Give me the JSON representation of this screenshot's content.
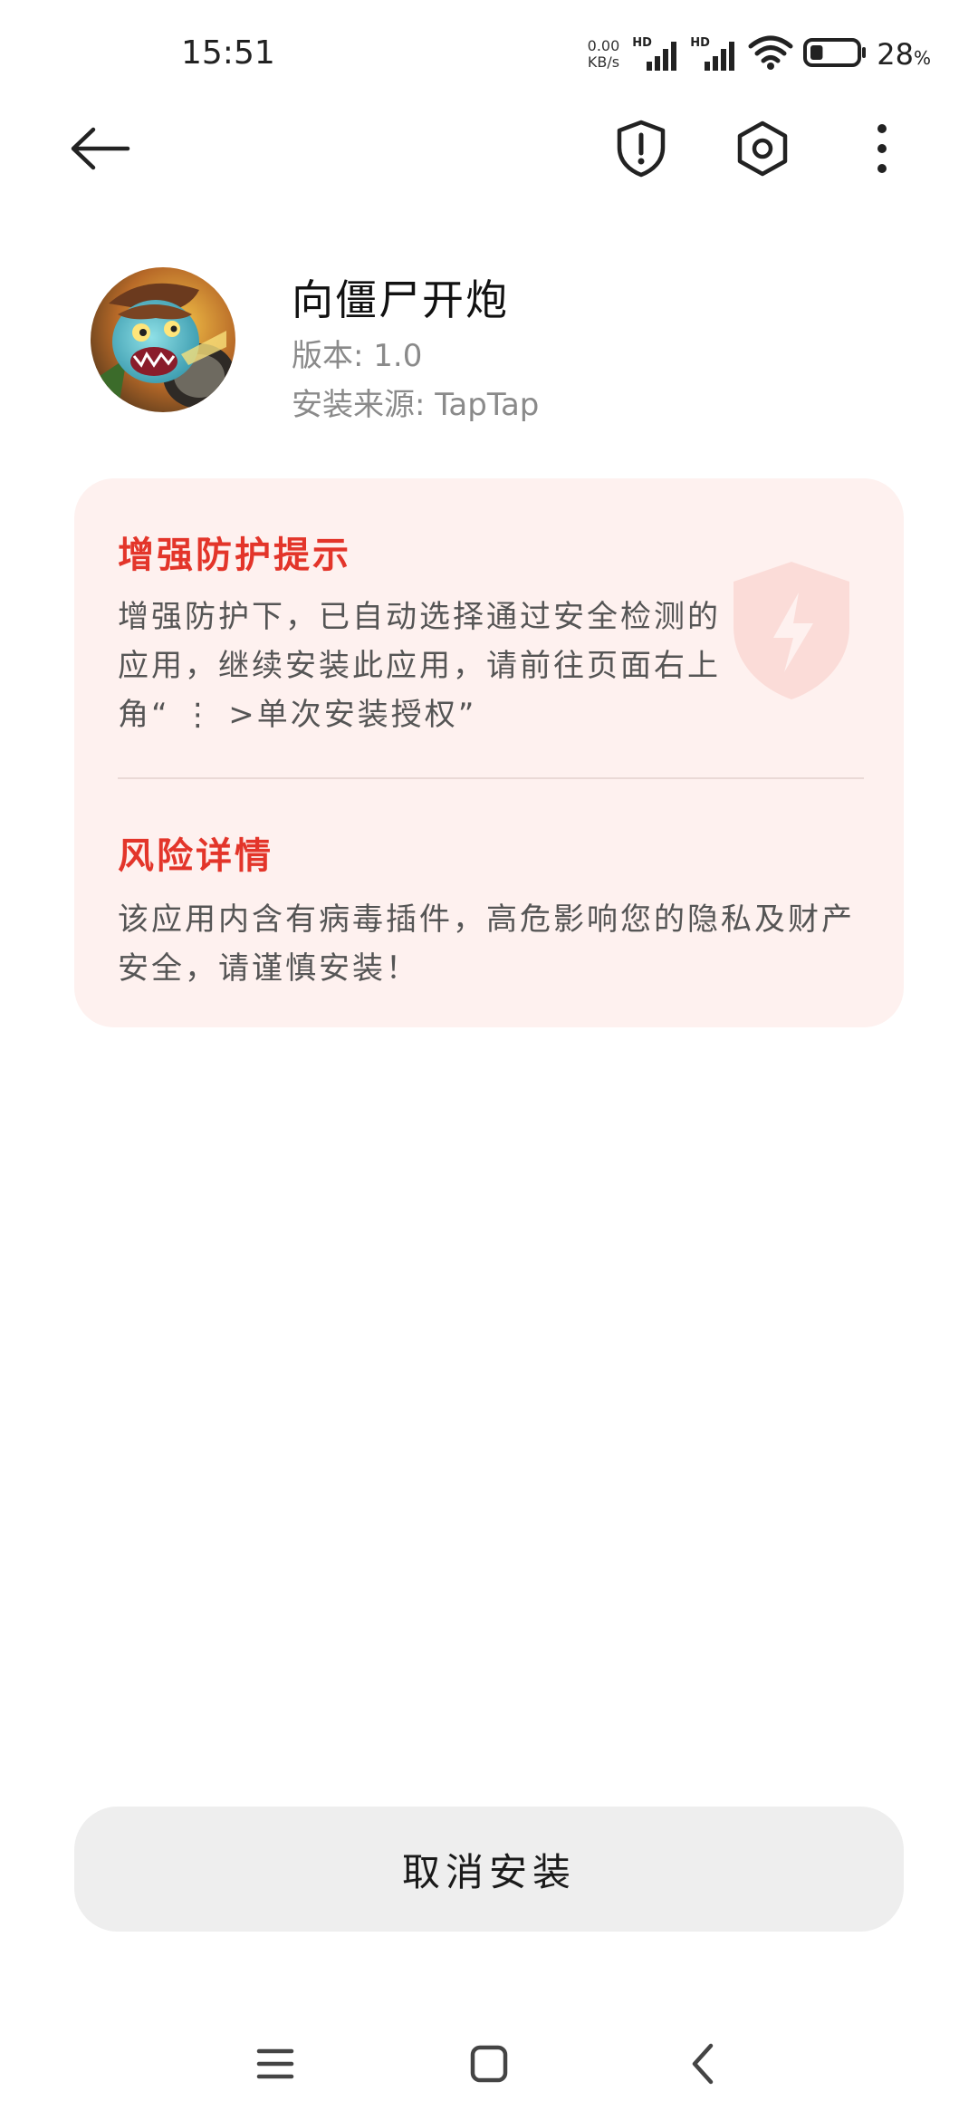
{
  "status_bar": {
    "time": "15:51",
    "net_speed_value": "0.00",
    "net_speed_unit": "KB/s",
    "sim1_label": "HD",
    "sim2_label": "HD",
    "battery_percent": "28",
    "battery_symbol": "%",
    "battery_level": 0.28
  },
  "action_bar": {
    "icons": [
      "back-arrow-icon",
      "shield-alert-icon",
      "settings-hexagon-icon",
      "more-vertical-icon"
    ]
  },
  "app": {
    "name": "向僵尸开炮",
    "version": "版本: 1.0",
    "source": "安装来源: TapTap"
  },
  "warning_card": {
    "protection_title": "增强防护提示",
    "protection_text": "增强防护下，已自动选择通过安全检测的应用，继续安装此应用，请前往页面右上角“ ⋮ >单次安装授权”",
    "risk_title": "风险详情",
    "risk_text": "该应用内含有病毒插件，高危影响您的隐私及财产安全，请谨慎安装！"
  },
  "bottom": {
    "cancel_label": "取消安装"
  },
  "colors": {
    "danger": "#e3352a",
    "card_background": "#fef1ef",
    "button_background": "#eeeeee"
  }
}
